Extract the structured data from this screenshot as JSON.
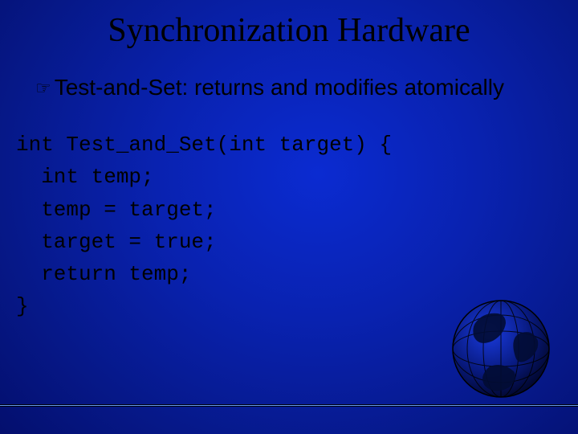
{
  "slide": {
    "title": "Synchronization Hardware",
    "bullet": {
      "icon": "☞",
      "text": "Test-and-Set: returns and modifies atomically"
    },
    "code": {
      "line1": "int Test_and_Set(int target) {",
      "line2": "  int temp;",
      "line3": "  temp = target;",
      "line4": "  target = true;",
      "line5": "  return temp;",
      "line6": "}"
    }
  }
}
